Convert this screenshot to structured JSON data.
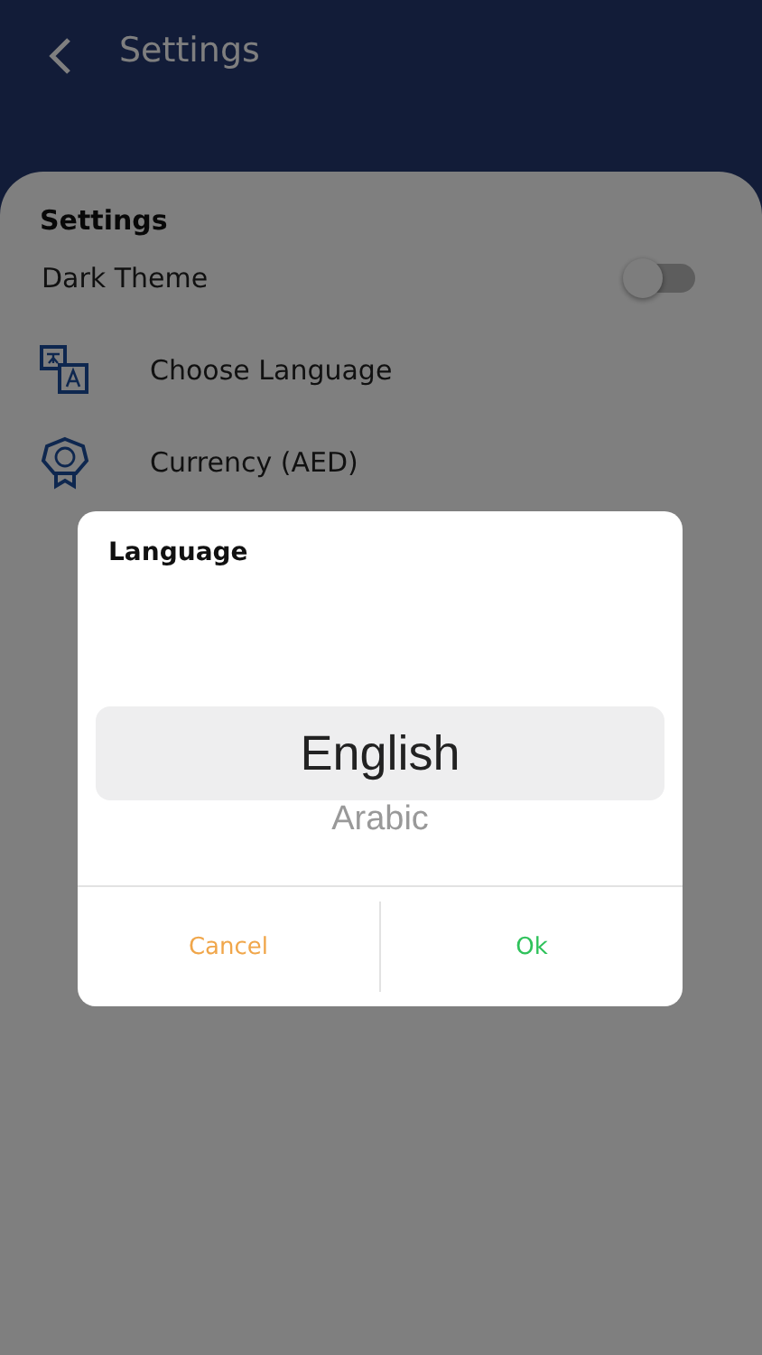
{
  "header": {
    "title": "Settings"
  },
  "card": {
    "title": "Settings",
    "items": [
      {
        "kind": "toggle",
        "label": "Dark Theme",
        "on": false
      },
      {
        "kind": "language",
        "label": "Choose Language"
      },
      {
        "kind": "currency",
        "label": "Currency (AED)"
      }
    ]
  },
  "dialog": {
    "title": "Language",
    "options": [
      {
        "label": "English",
        "selected": true
      },
      {
        "label": "Arabic",
        "selected": false
      }
    ],
    "buttons": [
      {
        "kind": "cancel",
        "label": "Cancel"
      },
      {
        "kind": "ok",
        "label": "Ok"
      }
    ]
  }
}
